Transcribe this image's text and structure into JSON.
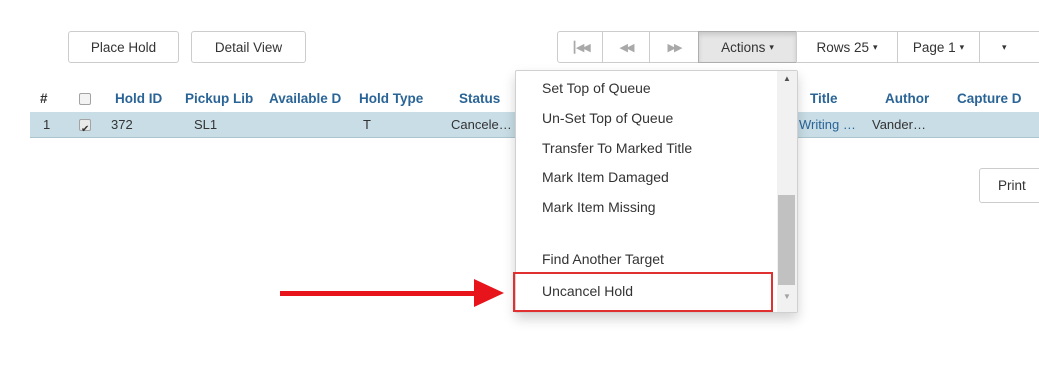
{
  "toolbar": {
    "place_hold": "Place Hold",
    "detail_view": "Detail View",
    "first_page_icon": "skip-to-start-icon",
    "prev_page_icon": "rewind-icon",
    "next_page_icon": "fast-forward-icon",
    "actions": "Actions",
    "rows": "Rows 25",
    "page": "Page 1",
    "caret": "▾",
    "print": "Print"
  },
  "grid": {
    "columns": [
      "#",
      "Hold ID",
      "Pickup Lib",
      "Available D",
      "Hold Type",
      "Status",
      "Title",
      "Author",
      "Capture D"
    ],
    "rows": [
      {
        "index": "1",
        "checked": true,
        "hold_id": "372",
        "pickup_lib": "SL1",
        "available_date": "",
        "hold_type": "T",
        "status": "Cancele…",
        "title": "Writing …",
        "author": "Vander…",
        "capture_date": ""
      }
    ]
  },
  "actions_menu": {
    "items": [
      "Set Top of Queue",
      "Un-Set Top of Queue",
      "Transfer To Marked Title",
      "Mark Item Damaged",
      "Mark Item Missing",
      "Find Another Target",
      "Uncancel Hold"
    ]
  },
  "annotation": {
    "highlighted_item": "Uncancel Hold",
    "arrow_color": "#e8141c",
    "box_color": "#e03030"
  },
  "colors": {
    "selected_row": "#c8dde6",
    "header_link": "#2a6496"
  }
}
